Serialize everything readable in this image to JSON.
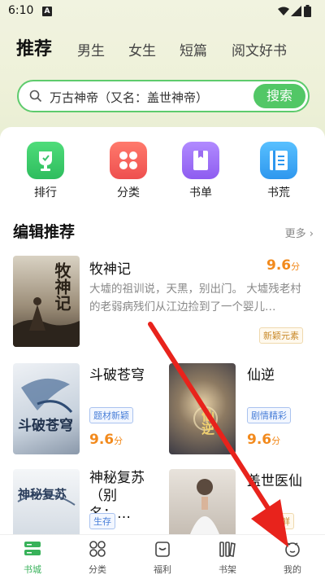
{
  "status_bar": {
    "time": "6:10",
    "notification_badge": "A"
  },
  "tabs": [
    {
      "label": "推荐",
      "active": true
    },
    {
      "label": "男生"
    },
    {
      "label": "女生"
    },
    {
      "label": "短篇"
    },
    {
      "label": "阅文好书"
    }
  ],
  "search": {
    "text": "万古神帝（又名：盖世神帝）",
    "button": "搜索"
  },
  "categories": [
    {
      "label": "排行",
      "icon": "trophy-icon",
      "color": "#3ccd6a"
    },
    {
      "label": "分类",
      "icon": "grid-icon",
      "color": "#f2645e"
    },
    {
      "label": "书单",
      "icon": "book-icon",
      "color": "#9b6cf1"
    },
    {
      "label": "书荒",
      "icon": "list-icon",
      "color": "#3aa7f4"
    }
  ],
  "section": {
    "title": "编辑推荐",
    "more": "更多"
  },
  "books": [
    {
      "title": "牧神记",
      "score": "9.6",
      "unit": "分",
      "desc": "大墟的祖训说，天黑，别出门。 大墟残老村的老弱病残们从江边捡到了一个婴儿…",
      "tag": "新颖元素",
      "cover_text": "牧神记"
    },
    {
      "title": "斗破苍穹",
      "score": "9.6",
      "unit": "分",
      "tag": "题材新颖",
      "cover_text": "斗破苍穹"
    },
    {
      "title": "仙逆",
      "score": "9.6",
      "unit": "分",
      "tag": "剧情精彩",
      "cover_text": "仙逆"
    },
    {
      "title": "神秘复苏（别名：…",
      "tag": "生存",
      "cover_text": "神秘复苏"
    },
    {
      "title": "盖世医仙",
      "tag": "新鲜"
    }
  ],
  "bottom_nav": [
    {
      "label": "书城",
      "active": true
    },
    {
      "label": "分类"
    },
    {
      "label": "福利"
    },
    {
      "label": "书架"
    },
    {
      "label": "我的"
    }
  ],
  "colors": {
    "accent": "#52c766",
    "score": "#f28a1d",
    "arrow": "#e8231c"
  }
}
